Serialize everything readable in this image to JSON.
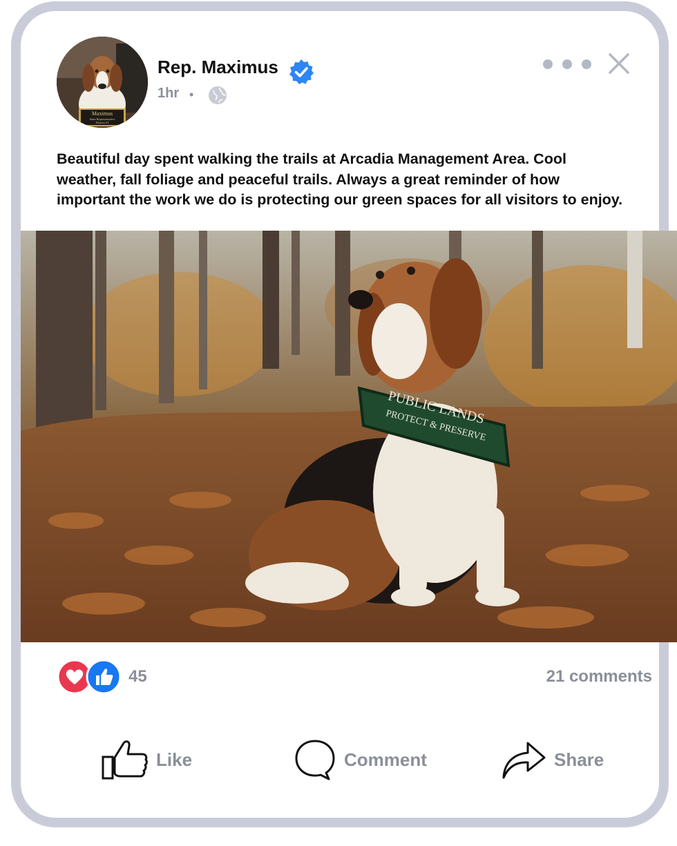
{
  "post": {
    "author": "Rep. Maximus",
    "time": "1hr",
    "separator": "•",
    "text": "Beautiful day spent walking the trails at Arcadia Management Area. Cool weather, fall foliage and peaceful trails. Always a great reminder of how important the work we do is protecting our green spaces for all visitors to enjoy.",
    "avatar_plaque": {
      "name": "Maximus",
      "title": "State Representative",
      "district": "District 21"
    },
    "photo_harness": {
      "line1": "PUBLIC LANDS",
      "line2": "PROTECT & PRESERVE"
    }
  },
  "stats": {
    "reactions_count": "45",
    "comments": "21 comments"
  },
  "actions": {
    "like": "Like",
    "comment": "Comment",
    "share": "Share"
  },
  "colors": {
    "frame": "#c9ccd8",
    "verified": "#2d86f5",
    "like_blue": "#1877f2",
    "love_red": "#e8384f",
    "muted_text": "#8a8f99"
  },
  "icons": [
    "verified-badge-icon",
    "globe-icon",
    "more-options-icon",
    "close-icon",
    "love-reaction-icon",
    "like-reaction-icon",
    "thumbs-up-icon",
    "comment-bubble-icon",
    "share-arrow-icon"
  ]
}
